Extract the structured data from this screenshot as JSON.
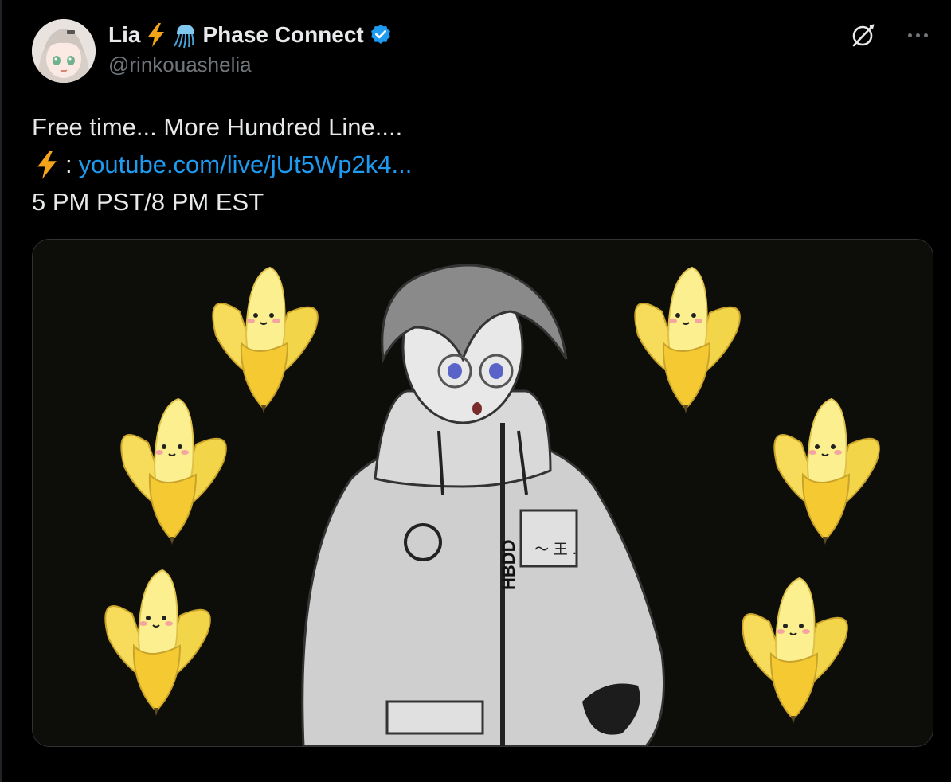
{
  "author": {
    "display_name": "Lia",
    "org": "Phase Connect",
    "handle": "@rinkouashelia",
    "verified": true
  },
  "icons": {
    "bolt": "high-voltage-emoji",
    "jellyfish": "jellyfish-emoji",
    "verified": "verified-badge-icon",
    "grok": "grok-icon",
    "more": "more-options-icon"
  },
  "tweet": {
    "line1": "Free time... More Hundred Line....",
    "line2_prefix": ":",
    "line2_link": "youtube.com/live/jUt5Wp2k4...",
    "line3": "5 PM PST/8 PM EST"
  },
  "media": {
    "jacket_text": "HBDD",
    "pocket_text": "〜 王 ."
  },
  "colors": {
    "background": "#000000",
    "text": "#e7e9ea",
    "secondary": "#71767b",
    "link": "#1d9bf0",
    "verified": "#1d9bf0",
    "bolt": "#f4a41a"
  }
}
